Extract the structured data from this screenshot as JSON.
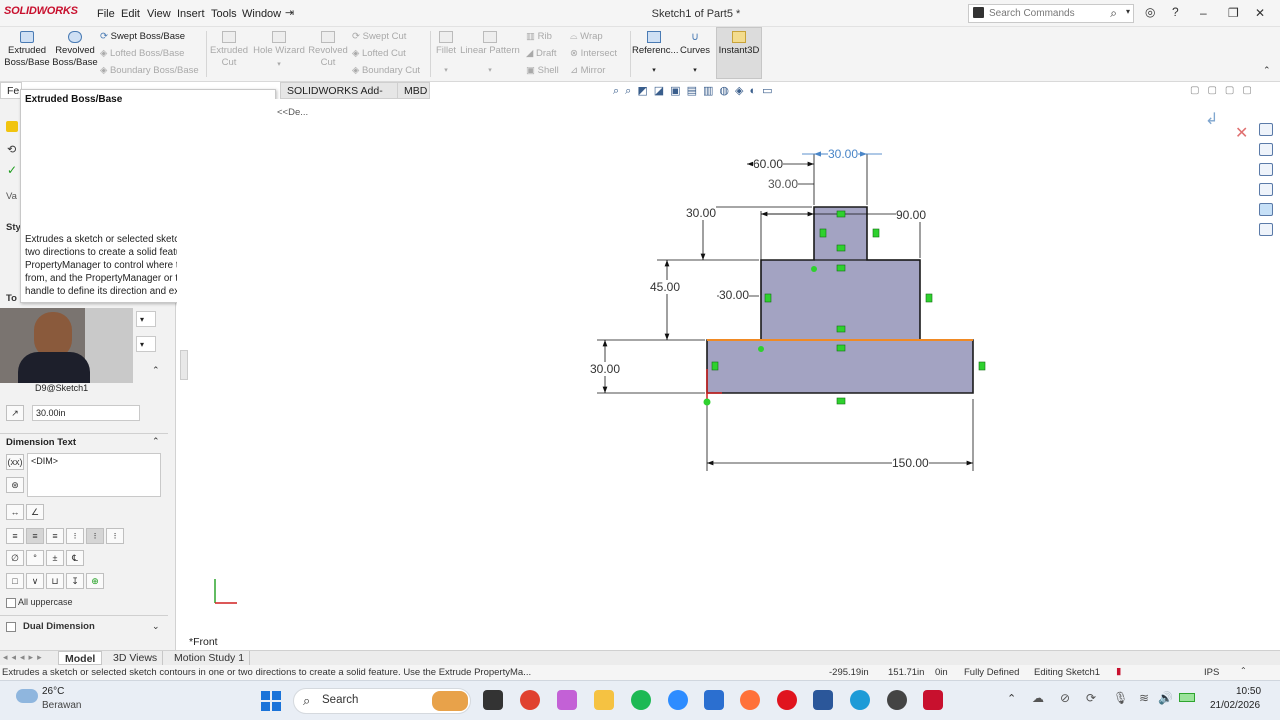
{
  "app": {
    "logo": "SOLIDWORKS",
    "menus": [
      "File",
      "Edit",
      "View",
      "Insert",
      "Tools",
      "Window"
    ],
    "doc_title": "Sketch1 of Part5 *",
    "search_placeholder": "Search Commands"
  },
  "ribbon": {
    "extruded_boss": "Extruded Boss/Base",
    "revolved_boss": "Revolved Boss/Base",
    "swept_boss": "Swept Boss/Base",
    "lofted_boss": "Lofted Boss/Base",
    "boundary_boss": "Boundary Boss/Base",
    "extruded_cut": "Extruded Cut",
    "hole_wizard": "Hole Wizard",
    "revolved_cut": "Revolved Cut",
    "swept_cut": "Swept Cut",
    "lofted_cut": "Lofted Cut",
    "boundary_cut": "Boundary Cut",
    "fillet": "Fillet",
    "linear_pattern": "Linear Pattern",
    "rib": "Rib",
    "draft": "Draft",
    "shell": "Shell",
    "wrap": "Wrap",
    "intersect": "Intersect",
    "mirror": "Mirror",
    "reference": "Referenc...",
    "curves": "Curves",
    "instant3d": "Instant3D"
  },
  "tabs": {
    "fe": "Fe",
    "addins": "SOLIDWORKS Add-Ins",
    "mbd": "MBD"
  },
  "tooltip": {
    "title": "Extruded Boss/Base",
    "description": "Extrudes a sketch or selected sketch contours in one or two directions to create a solid feature. Use the Extrude PropertyManager to control where the extrude starts from, and the PropertyManager or the Instant 3D drag handle to define its direction and extent."
  },
  "property_manager": {
    "va": "Va",
    "sty": "Sty",
    "to": "To",
    "dim_name": "D9@Sketch1",
    "dim_value": "30.00in",
    "dimension_text_header": "Dimension Text",
    "dim_text": "<DIM>",
    "all_uppercase": "All uppercase",
    "dual_dimension": "Dual Dimension"
  },
  "graphics": {
    "tree_label": "<<De...",
    "view_label": "*Front",
    "dims": {
      "d_60": "60.00",
      "d_30_top": "30.00",
      "d_30_top2": "30.00",
      "d_30_left": "30.00",
      "d_90": "90.00",
      "d_45": "45.00",
      "d_30_mid": "30.00",
      "d_30_bottom": "30.00",
      "d_150": "150.00"
    }
  },
  "bottom_tabs": [
    "Model",
    "3D Views",
    "Motion Study 1"
  ],
  "status": {
    "message": "Extrudes a sketch or selected sketch contours in one or two directions to create a solid feature. Use the Extrude PropertyMa...",
    "x": "-295.19in",
    "y": "151.71in",
    "z": "0in",
    "state": "Fully Defined",
    "editing": "Editing Sketch1",
    "units": "IPS"
  },
  "taskbar": {
    "weather_temp": "26°C",
    "weather_desc": "Berawan",
    "search": "Search",
    "time": "10:50",
    "date": "21/02/2026"
  },
  "colors": {
    "sketch_fill": "#a3a3c2",
    "sketch_line": "#1a1a1a",
    "selected_edge": "#f08a24",
    "relation_green": "#2ed12e",
    "dimension_blue": "#4a86c8",
    "solidworks_red": "#c8102e"
  }
}
